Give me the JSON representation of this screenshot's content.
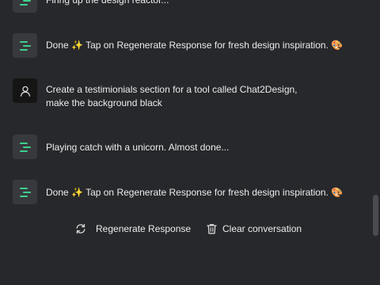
{
  "messages": [
    {
      "role": "bot",
      "icon": "bot-lines-icon",
      "text": "Firing up the design reactor..."
    },
    {
      "role": "bot",
      "icon": "bot-lines-icon",
      "text": "Done ✨ Tap on Regenerate Response for fresh design inspiration. 🎨"
    },
    {
      "role": "user",
      "icon": "user-icon",
      "text": "Create a testimionials section for a tool called Chat2Design, make the background black"
    },
    {
      "role": "bot",
      "icon": "bot-lines-icon",
      "text": "Playing catch with a unicorn. Almost done..."
    },
    {
      "role": "bot",
      "icon": "bot-lines-icon",
      "text": "Done ✨ Tap on Regenerate Response for fresh design inspiration. 🎨"
    }
  ],
  "actions": {
    "regenerate_label": "Regenerate Response",
    "clear_label": "Clear conversation"
  },
  "colors": {
    "background": "#27282b",
    "bot_avatar_bg": "#38393c",
    "user_avatar_bg": "#151515",
    "accent_green": "#3ecf8e",
    "text": "#ececec"
  }
}
